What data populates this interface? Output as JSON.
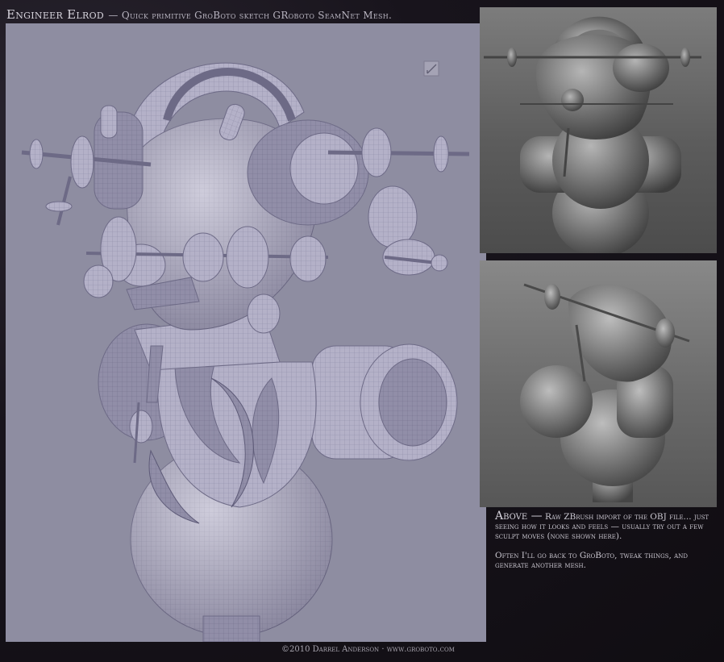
{
  "header": {
    "title": "Engineer Elrod",
    "subtitle": "— Quick primitive GroBoto sketch GRoboto SeamNet Mesh."
  },
  "caption": {
    "heading": "Above —",
    "para1": "Raw ZBrush import of the OBJ file... just seeing how it looks and feels — usually try out a few sculpt moves (none shown here).",
    "para2": "Often I'll go back to GroBoto, tweak things, and generate another mesh."
  },
  "footer": {
    "credit": "©2010 Darrel Anderson · www.groboto.com"
  },
  "colors": {
    "page_background": "#151218",
    "main_panel": "#8e8da1",
    "model_mesh": "#b9b6cc",
    "render_panel": "#6c6c6c",
    "text": "#c9c6cf"
  },
  "icons": {
    "viewport_marker": "square-pen-icon"
  }
}
